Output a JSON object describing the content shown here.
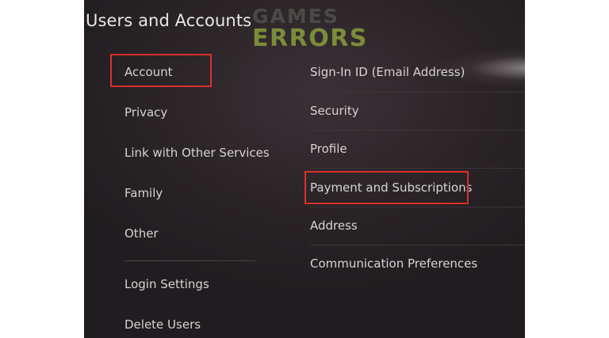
{
  "header": {
    "title": "Users and Accounts",
    "watermark_line1": "GAMES",
    "watermark_line2": "ERRORS"
  },
  "left_menu": {
    "items": [
      {
        "label": "Account",
        "selected": true,
        "highlighted": true
      },
      {
        "label": "Privacy"
      },
      {
        "label": "Link with Other Services"
      },
      {
        "label": "Family"
      },
      {
        "label": "Other"
      },
      {
        "label": "Login Settings"
      },
      {
        "label": "Delete Users"
      }
    ]
  },
  "right_menu": {
    "items": [
      {
        "label": "Sign-In ID (Email Address)"
      },
      {
        "label": "Security"
      },
      {
        "label": "Profile"
      },
      {
        "label": "Payment and Subscriptions",
        "highlighted": true
      },
      {
        "label": "Address"
      },
      {
        "label": "Communication Preferences"
      }
    ]
  },
  "colors": {
    "highlight": "#d9302b",
    "text": "#d6d3d5",
    "background": "#2a2427",
    "watermark_accent": "#7b8c3a"
  }
}
